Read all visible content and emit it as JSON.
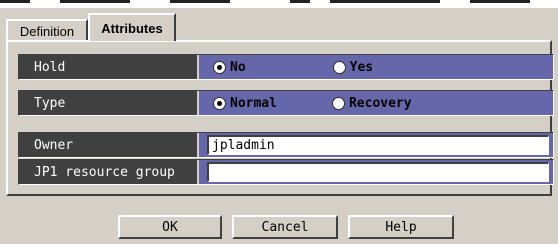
{
  "tabs": [
    {
      "label": "Definition",
      "active": false
    },
    {
      "label": "Attributes",
      "active": true
    }
  ],
  "rows": {
    "hold": {
      "label": "Hold",
      "options": [
        {
          "label": "No",
          "checked": true
        },
        {
          "label": "Yes",
          "checked": false
        }
      ]
    },
    "type": {
      "label": "Type",
      "options": [
        {
          "label": "Normal",
          "checked": true
        },
        {
          "label": "Recovery",
          "checked": false
        }
      ]
    },
    "owner": {
      "label": "Owner",
      "value": "jpladmin"
    },
    "jp1_group": {
      "label": "JP1 resource group",
      "value": ""
    }
  },
  "buttons": {
    "ok": "OK",
    "cancel": "Cancel",
    "help": "Help"
  },
  "colors": {
    "dialog_bg": "#d4d0c8",
    "label_bg": "#404040",
    "value_bg": "#6666aa"
  }
}
